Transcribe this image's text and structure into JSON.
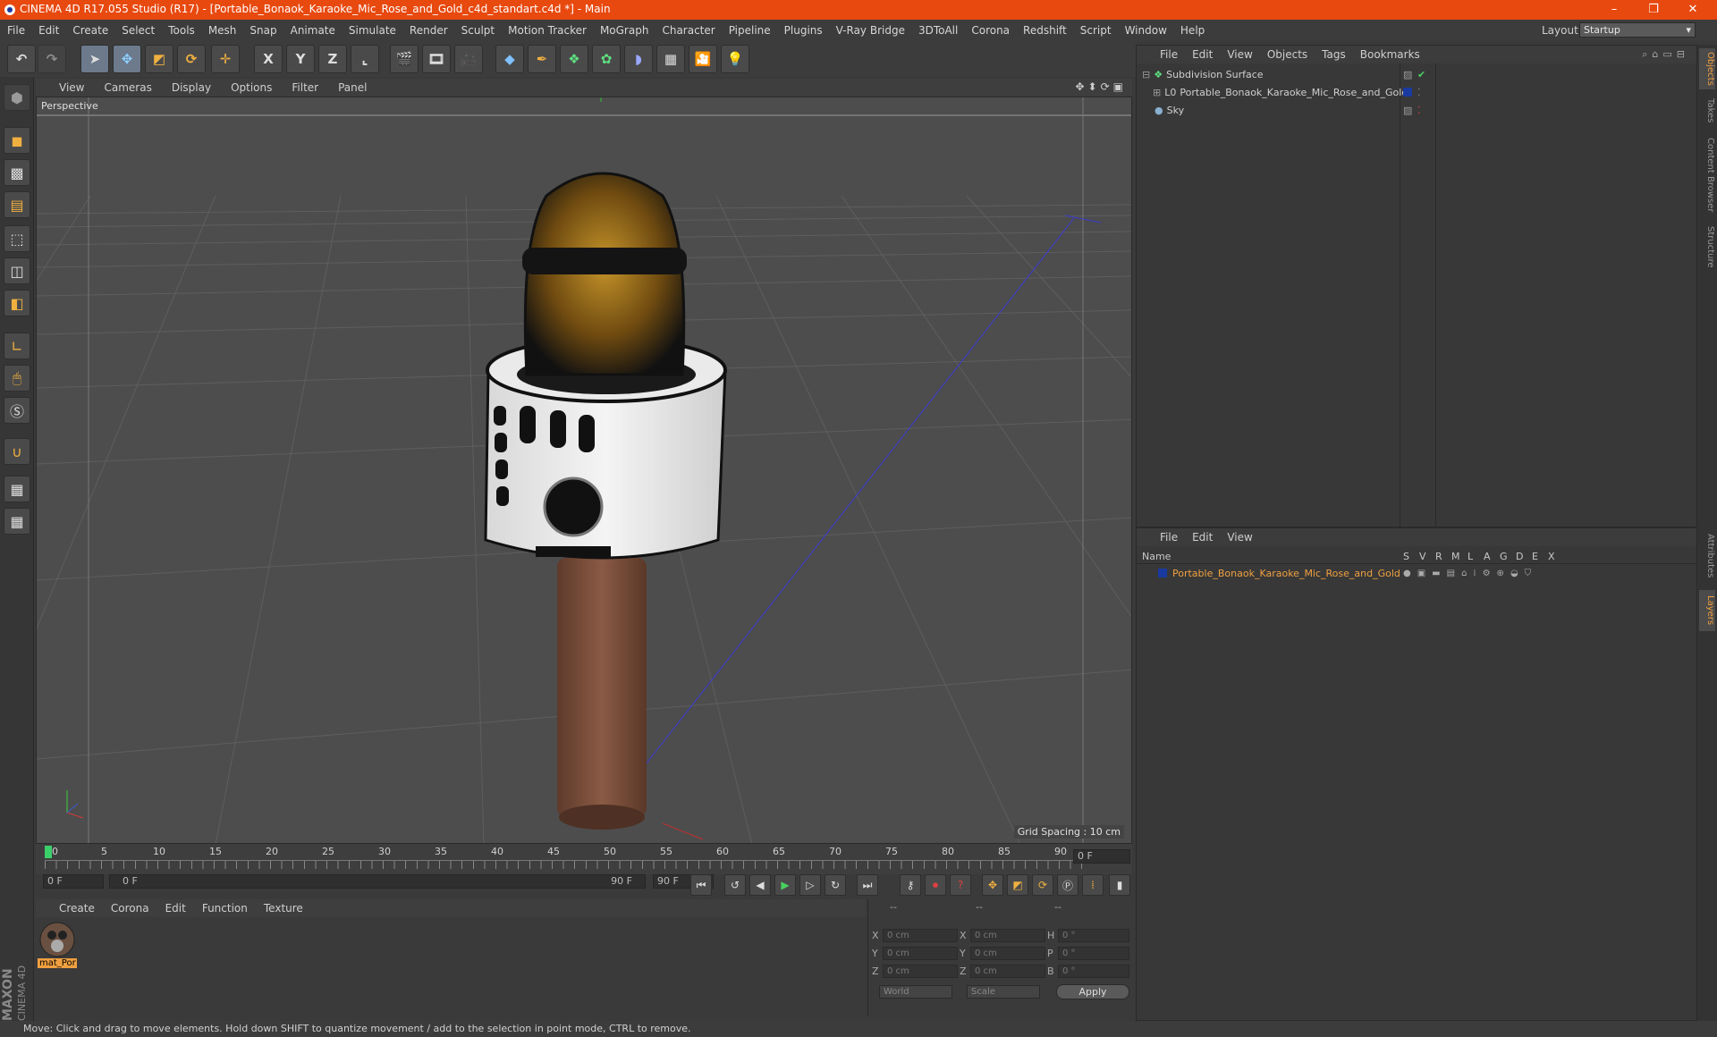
{
  "window": {
    "title": "CINEMA 4D R17.055 Studio (R17) - [Portable_Bonaok_Karaoke_Mic_Rose_and_Gold_c4d_standart.c4d *] - Main",
    "min": "–",
    "max": "❐",
    "close": "✕"
  },
  "menu": [
    "File",
    "Edit",
    "Create",
    "Select",
    "Tools",
    "Mesh",
    "Snap",
    "Animate",
    "Simulate",
    "Render",
    "Sculpt",
    "Motion Tracker",
    "MoGraph",
    "Character",
    "Pipeline",
    "Plugins",
    "V-Ray Bridge",
    "3DToAll",
    "Corona",
    "Redshift",
    "Script",
    "Window",
    "Help"
  ],
  "layout": {
    "label": "Layout:",
    "value": "Startup"
  },
  "toolbar": {
    "x": "X",
    "y": "Y",
    "z": "Z"
  },
  "viewport": {
    "menu": [
      "View",
      "Cameras",
      "Display",
      "Options",
      "Filter",
      "Panel"
    ],
    "label": "Perspective",
    "grid_spacing": "Grid Spacing : 10 cm"
  },
  "timeline": {
    "ticks": [
      "0",
      "5",
      "10",
      "15",
      "20",
      "25",
      "30",
      "35",
      "40",
      "45",
      "50",
      "55",
      "60",
      "65",
      "70",
      "75",
      "80",
      "85",
      "90"
    ],
    "current": "0 F",
    "start": "0 F",
    "range_start": "0 F",
    "range_end": "90 F",
    "end": "90 F"
  },
  "objects": {
    "menu": [
      "File",
      "Edit",
      "View",
      "Objects",
      "Tags",
      "Bookmarks"
    ],
    "items": [
      "Subdivision Surface",
      "Portable_Bonaok_Karaoke_Mic_Rose_and_Gold",
      "Sky"
    ]
  },
  "layers": {
    "menu": [
      "File",
      "Edit",
      "View"
    ],
    "columns": [
      "Name",
      "S",
      "V",
      "R",
      "M",
      "L",
      "A",
      "G",
      "D",
      "E",
      "X"
    ],
    "item": "Portable_Bonaok_Karaoke_Mic_Rose_and_Gold"
  },
  "materials": {
    "menu": [
      "Create",
      "Corona",
      "Edit",
      "Function",
      "Texture"
    ],
    "item": "mat_Por"
  },
  "coords": {
    "headers": [
      "--",
      "--",
      "--"
    ],
    "row_labels_left": [
      "X",
      "Y",
      "Z"
    ],
    "row_labels_mid": [
      "X",
      "Y",
      "Z"
    ],
    "row_labels_right": [
      "H",
      "P",
      "B"
    ],
    "pos": [
      "0 cm",
      "0 cm",
      "0 cm"
    ],
    "size": [
      "0 cm",
      "0 cm",
      "0 cm"
    ],
    "rot": [
      "0 °",
      "0 °",
      "0 °"
    ],
    "world": "World",
    "scale": "Scale",
    "apply": "Apply"
  },
  "right_tabs": [
    "Objects",
    "Takes",
    "Content Browser",
    "Structure",
    "Attributes",
    "Layers"
  ],
  "brand": {
    "line1": "MAXON",
    "line2": "CINEMA 4D"
  },
  "status": "Move: Click and drag to move elements. Hold down SHIFT to quantize movement / add to the selection in point mode, CTRL to remove.",
  "colors": {
    "title_bar": "#e8490f",
    "accent": "#f0a040",
    "layer_blue": "#1a3aa0"
  }
}
